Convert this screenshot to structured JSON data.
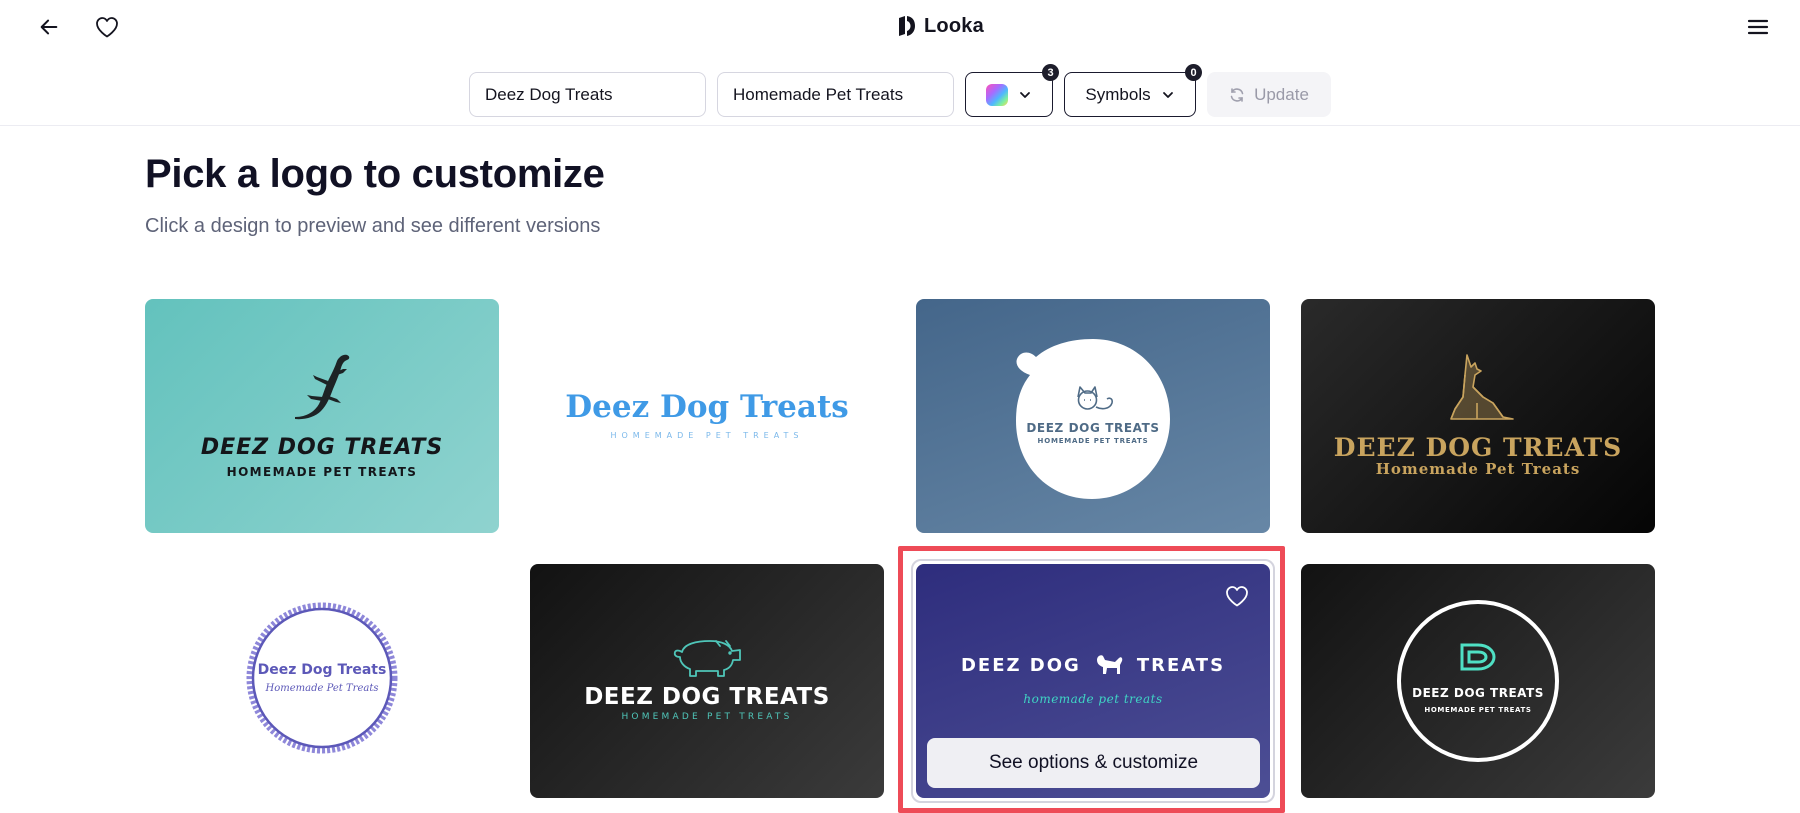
{
  "header": {
    "brand_name": "Looka",
    "icons": [
      "back-arrow-icon",
      "heart-icon",
      "looka-logo-icon",
      "hamburger-menu-icon"
    ]
  },
  "toolbar": {
    "company_name_value": "Deez Dog Treats",
    "slogan_value": "Homemade Pet Treats",
    "colors_badge": "3",
    "symbols_label": "Symbols",
    "symbols_badge": "0",
    "update_label": "Update"
  },
  "main": {
    "title": "Pick a logo to customize",
    "subtitle": "Click a design to preview and see different versions"
  },
  "logos": [
    {
      "title": "DEEZ DOG TREATS",
      "tagline": "HOMEMADE PET TREATS",
      "background": "#7ccbc7",
      "symbol": "lizard-icon"
    },
    {
      "title": "Deez Dog Treats",
      "tagline": "HOMEMADE PET TREATS",
      "background": "#ffffff",
      "symbol": "none"
    },
    {
      "title": "DEEZ DOG TREATS",
      "tagline": "HOMEMADE PET TREATS",
      "background": "#56779a",
      "symbol": "cat-icon"
    },
    {
      "title": "DEEZ DOG TREATS",
      "tagline": "Homemade Pet Treats",
      "background": "#111111",
      "symbol": "sitting-dog-icon"
    },
    {
      "title": "Deez Dog Treats",
      "tagline": "Homemade Pet Treats",
      "background": "#ffffff",
      "symbol": "brush-circle-icon"
    },
    {
      "title": "DEEZ DOG TREATS",
      "tagline": "HOMEMADE PET TREATS",
      "background": "#262626",
      "symbol": "pig-icon"
    },
    {
      "title": "DEEZ DOG",
      "title_after": "TREATS",
      "tagline": "homemade pet treats",
      "background": "#3c3b87",
      "symbol": "dog-icon"
    },
    {
      "title": "DEEZ DOG TREATS",
      "tagline": "HOMEMADE PET TREATS",
      "background": "#262626",
      "symbol": "letter-d-monogram-icon"
    }
  ],
  "selected_card": {
    "cta_label": "See options & customize",
    "highlight_color": "#ee4b57"
  }
}
